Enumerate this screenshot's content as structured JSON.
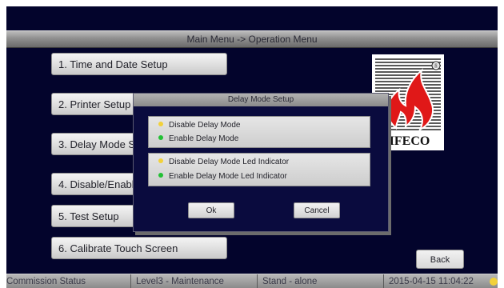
{
  "header": {
    "title": "Main Menu -> Operation Menu"
  },
  "menu": {
    "items": [
      {
        "label": "1. Time and Date Setup"
      },
      {
        "label": "2. Printer Setup"
      },
      {
        "label": "3. Delay Mode Setup"
      },
      {
        "label": "4. Disable/Enable"
      },
      {
        "label": "5. Test Setup"
      },
      {
        "label": "6. Calibrate Touch Screen"
      }
    ]
  },
  "logo": {
    "brand": "IFECO",
    "mark": "®"
  },
  "back_button": {
    "label": "Back"
  },
  "dialog": {
    "title": "Delay Mode Setup",
    "group1": [
      {
        "label": "Disable Delay Mode",
        "led": "yellow"
      },
      {
        "label": "Enable Delay Mode",
        "led": "green"
      }
    ],
    "group2": [
      {
        "label": "Disable Delay Mode Led Indicator",
        "led": "yellow"
      },
      {
        "label": "Enable Delay Mode Led Indicator",
        "led": "green"
      }
    ],
    "ok_label": "Ok",
    "cancel_label": "Cancel"
  },
  "status_bar": {
    "commission_status": "Commission Status",
    "level": "Level3 - Maintenance",
    "mode": "Stand - alone",
    "datetime": "2015-04-15 11:04:22",
    "led": "yellow"
  },
  "colors": {
    "background": "#03042c",
    "led_yellow": "#f2d13a",
    "led_green": "#22c034",
    "logo_red": "#e01818"
  }
}
